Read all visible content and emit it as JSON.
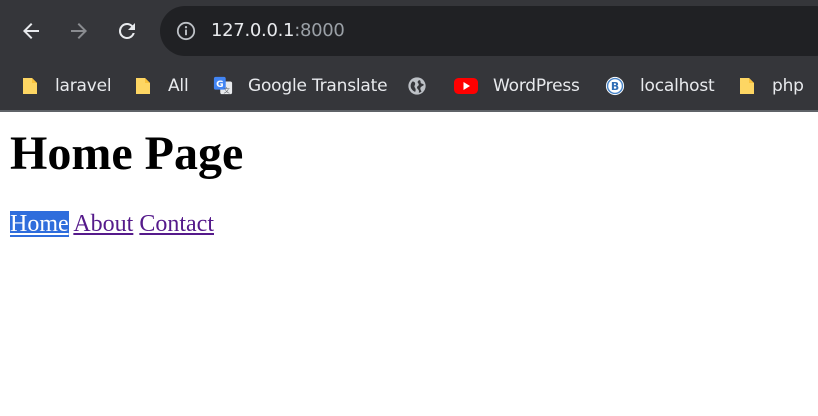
{
  "browser": {
    "url_host": "127.0.0.1",
    "url_port": ":8000",
    "icons": {
      "back": "arrow-left-icon",
      "forward": "arrow-right-icon",
      "reload": "reload-icon",
      "site_info": "info-icon"
    },
    "bookmarks": [
      {
        "label": "laravel",
        "icon": "folder-icon"
      },
      {
        "label": "All",
        "icon": "folder-icon"
      },
      {
        "label": "Google Translate",
        "icon": "google-translate-icon"
      },
      {
        "label": "",
        "icon": "globe-icon"
      },
      {
        "label": "WordPress",
        "icon": "youtube-icon"
      },
      {
        "label": "localhost",
        "icon": "b-badge-icon"
      },
      {
        "label": "php",
        "icon": "folder-icon"
      }
    ]
  },
  "page": {
    "title": "Home Page",
    "nav": [
      {
        "label": "Home",
        "selected": true
      },
      {
        "label": "About",
        "selected": false
      },
      {
        "label": "Contact",
        "selected": false
      }
    ]
  },
  "colors": {
    "chrome_bg": "#35363a",
    "omnibox_bg": "#202124",
    "chrome_text": "#e8eaed",
    "port_text": "#9aa0a6",
    "visited_link": "#551a8b",
    "selection": "#2f6ddc",
    "folder": "#fdd663",
    "youtube_red": "#ff0000"
  }
}
